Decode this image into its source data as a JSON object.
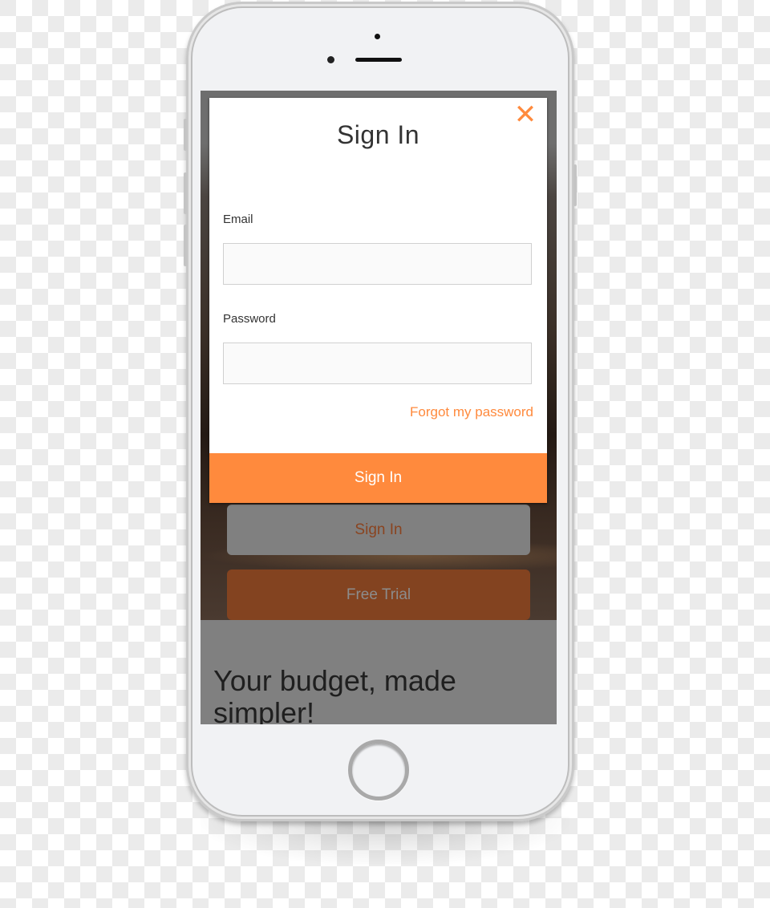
{
  "device": {
    "type": "smartphone mockup"
  },
  "modal": {
    "title": "Sign In",
    "close_icon": "close-icon",
    "email_label": "Email",
    "email_value": "",
    "email_placeholder": "",
    "password_label": "Password",
    "password_value": "",
    "password_placeholder": "",
    "forgot_link": "Forgot my password",
    "submit_label": "Sign In"
  },
  "page": {
    "signin_button": "Sign In",
    "free_trial_button": "Free Trial",
    "tagline": "Your budget, made simpler!"
  },
  "colors": {
    "accent": "#ff8a3d",
    "free_trial_bg": "#834320",
    "dimmed_overlay": "#808080"
  }
}
